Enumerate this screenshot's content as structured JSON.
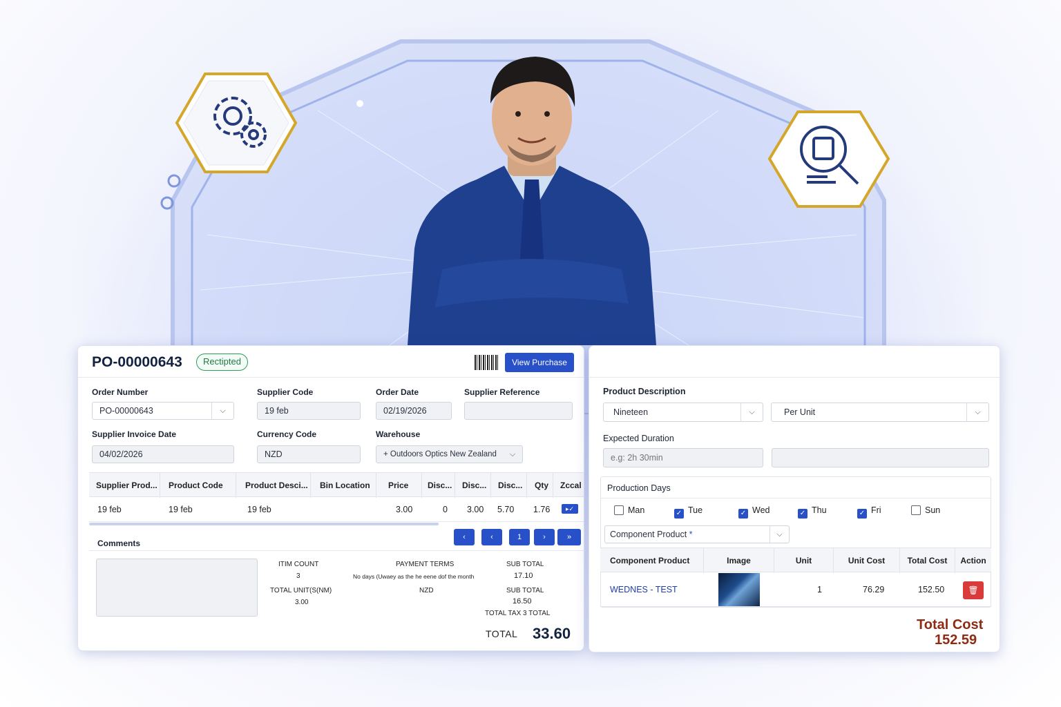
{
  "colors": {
    "accent": "#2750c9",
    "badge_green": "#2f9a5a",
    "total_cost": "#8e2b12",
    "danger": "#d93a3a",
    "hex_border": "#d4a62a"
  },
  "decor": {
    "left_hex_icon": "gears-icon",
    "right_hex_icon": "clipboard-search-icon",
    "person": "businessman-arms-crossed"
  },
  "purchase": {
    "title": "PO-00000643",
    "status": "Rectipted",
    "view_button": "View Purchase",
    "fields": {
      "order_number_label": "Order Number",
      "order_number": "PO-00000643",
      "supplier_code_label": "Supplier Code",
      "supplier_code": "19 feb",
      "order_date_label": "Order Date",
      "order_date": "02/19/2026",
      "supplier_reference_label": "Supplier Reference",
      "supplier_reference": "",
      "supplier_invoice_date_label": "Supplier Invoice Date",
      "supplier_invoice_date": "04/02/2026",
      "currency_code_label": "Currency Code",
      "currency_code": "NZD",
      "warehouse_label": "Warehouse",
      "warehouse": "+ Outdoors Optics New Zealand"
    },
    "table": {
      "headers": [
        "Supplier Prod...",
        "Product Code",
        "Product Desci...",
        "Bin Location",
        "Price",
        "Disc...",
        "Disc...",
        "Disc...",
        "Qty",
        "Zccal"
      ],
      "rows": [
        {
          "supplier_prod": "19 feb",
          "product_code": "19 feb",
          "product_desc": "19 feb",
          "bin": "",
          "price": "3.00",
          "disc1": "0",
          "disc2": "3.00",
          "disc3": "5.70",
          "qty": "1.76"
        }
      ]
    },
    "pager": [
      "‹",
      "‹",
      "1",
      "›",
      "»"
    ],
    "comments_label": "Comments",
    "summary": {
      "item_count_label": "ITIM COUNT",
      "item_count": "3",
      "total_units_label": "TOTAL UNIT(S(NM)",
      "total_units": "3.00",
      "payment_terms_label": "PAYMENT TERMS",
      "payment_terms": "No days (Uwaey as the he eene dof the month",
      "currency": "NZD",
      "sub_total_label_1": "SUB TOTAL",
      "sub_total_1": "17.10",
      "sub_total_label_2": "SUB TOTAL",
      "sub_total_2": "16.50",
      "total_tax_label": "TOTAL TAX  3 TOTAL",
      "total_label": "TOTAL",
      "total": "33.60"
    }
  },
  "product": {
    "description_label": "Product Description",
    "description": "Nineteen",
    "unit": "Per Unit",
    "expected_duration_label": "Expected Duration",
    "expected_duration_placeholder": "e.g: 2h 30min",
    "production_days_label": "Production Days",
    "days": [
      {
        "label": "Man",
        "checked": false
      },
      {
        "label": "Tue",
        "checked": true
      },
      {
        "label": "Wed",
        "checked": true
      },
      {
        "label": "Thu",
        "checked": true
      },
      {
        "label": "Fri",
        "checked": true
      },
      {
        "label": "Sun",
        "checked": false
      }
    ],
    "component_select": "Component Product",
    "table": {
      "headers": [
        "Component Product",
        "Image",
        "Unit",
        "Unit Cost",
        "Total Cost",
        "Action"
      ],
      "rows": [
        {
          "component": "WEDNES - TEST",
          "unit": "1",
          "unit_cost": "76.29",
          "total_cost": "152.50"
        }
      ]
    },
    "total_cost_label": "Total Cost",
    "total_cost": "152.59"
  }
}
